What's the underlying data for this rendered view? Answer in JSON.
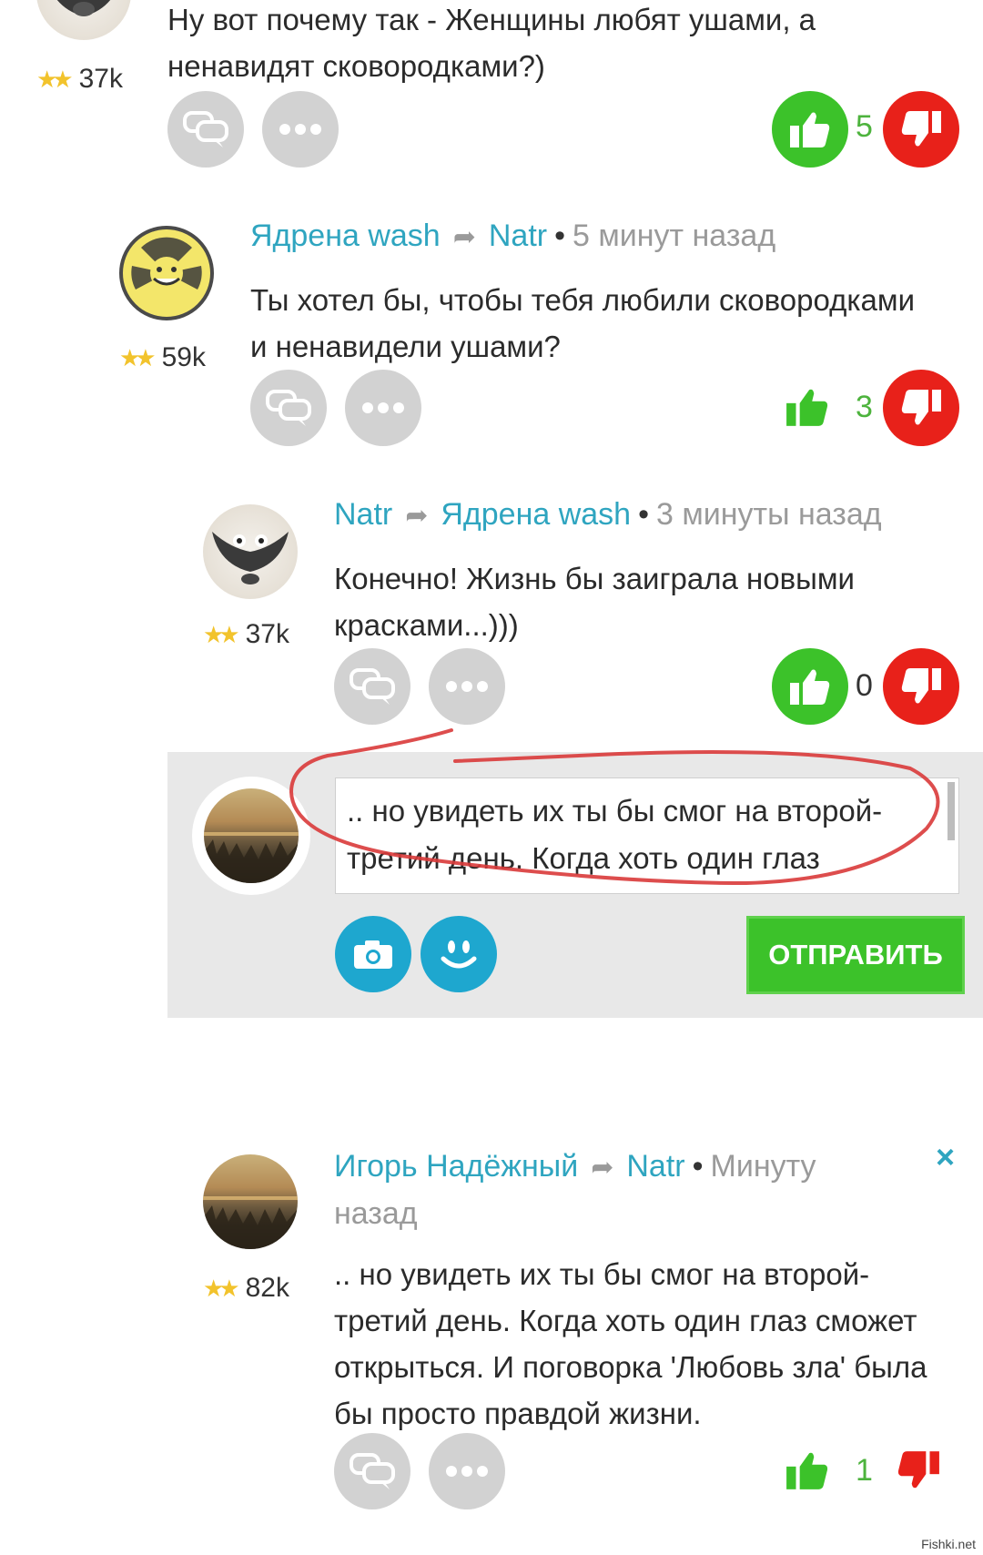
{
  "comments": [
    {
      "rating": "37k",
      "text_lines": [
        "Ну вот почему так - Женщины любят ушами, а",
        "ненавидят сковородками?)"
      ],
      "likes": "5"
    },
    {
      "author": "Ядрена wash",
      "reply_to": "Natr",
      "time": "5 минут назад",
      "rating": "59k",
      "text_lines": [
        "Ты хотел бы, чтобы тебя любили сковородками",
        "и ненавидели ушами?"
      ],
      "likes": "3"
    },
    {
      "author": "Natr",
      "reply_to": "Ядрена wash",
      "time": "3 минуты назад",
      "rating": "37k",
      "text_lines": [
        "Конечно! Жизнь бы заиграла новыми",
        "красками...)))"
      ],
      "likes": "0"
    },
    {
      "author": "Игорь Надёжный",
      "reply_to": "Natr",
      "time_line1": "Минуту",
      "time_line2": "назад",
      "rating": "82k",
      "text_lines": [
        ".. но увидеть их ты бы смог на второй-",
        "третий день. Когда хоть один глаз сможет",
        "открыться. И поговорка 'Любовь зла' была",
        "бы просто правдой жизни."
      ],
      "likes": "1"
    }
  ],
  "compose": {
    "text_lines": [
      ".. но увидеть их ты бы смог на второй-",
      "третий день.  Когда хоть один глаз"
    ],
    "send_label": "ОТПРАВИТЬ"
  },
  "close_label": "×",
  "watermark": "Fishki.net",
  "colors": {
    "author": "#2fa5c0",
    "like_green": "#3cc22a",
    "dislike_red": "#e8211a",
    "icon_grey": "#d2d2d2",
    "annotation_circle": "#d93a3a"
  }
}
